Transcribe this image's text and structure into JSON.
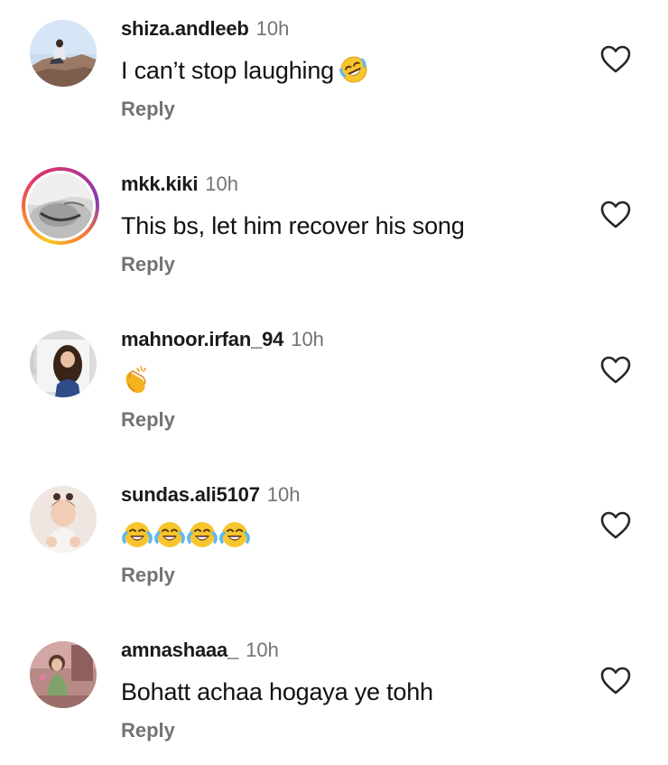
{
  "comments": [
    {
      "username": "shiza.andleeb",
      "time": "10h",
      "text": "I can’t stop laughing",
      "emoji": "rolling-on-floor-laughing",
      "reply_label": "Reply",
      "avatar": "avatar-photo-person-on-rocks",
      "has_story_ring": false
    },
    {
      "username": "mkk.kiki",
      "time": "10h",
      "text": "This bs, let him recover his song",
      "reply_label": "Reply",
      "avatar": "avatar-photo-monochrome",
      "has_story_ring": true
    },
    {
      "username": "mahnoor.irfan_94",
      "time": "10h",
      "text": "",
      "emoji": "clapping-hands",
      "reply_label": "Reply",
      "avatar": "avatar-photo-mug-illustration",
      "has_story_ring": false
    },
    {
      "username": "sundas.ali5107",
      "time": "10h",
      "text": "",
      "emoji": "face-with-tears-of-joy x4",
      "reply_label": "Reply",
      "avatar": "avatar-photo-child",
      "has_story_ring": false
    },
    {
      "username": "amnashaaa_",
      "time": "10h",
      "text": "Bohatt achaa hogaya ye tohh",
      "reply_label": "Reply",
      "avatar": "avatar-photo-person-outdoors",
      "has_story_ring": false
    }
  ],
  "icons": {
    "like": "heart-outline-icon"
  },
  "colors": {
    "username": "#1a1a1a",
    "secondary_text": "#737373",
    "story_ring": [
      "#f9c823",
      "#e1306c",
      "#833ab4"
    ]
  }
}
